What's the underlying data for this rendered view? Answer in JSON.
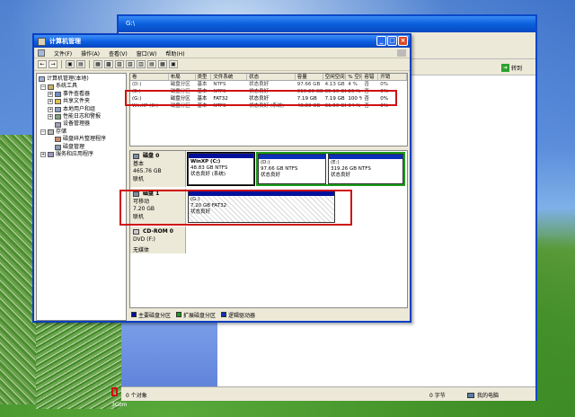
{
  "desktop": {
    "icon_label": "3Com"
  },
  "explorer": {
    "title": "G:\\",
    "go_label": "转到",
    "status_count": "0 个对象",
    "status_size": "0 字节",
    "status_location": "我的电脑"
  },
  "cm": {
    "title": "计算机管理",
    "menu": [
      "文件(F)",
      "操作(A)",
      "查看(V)",
      "窗口(W)",
      "帮助(H)"
    ],
    "toolbar": [
      "←",
      "→",
      "▣",
      "▤",
      "▦",
      "▩",
      "▨",
      "▧",
      "▥",
      "▤",
      "▦",
      "▣"
    ],
    "window_buttons": [
      "_",
      "□",
      "×"
    ]
  },
  "tree": {
    "root": "计算机管理(本地)",
    "system_tools": "系统工具",
    "event_viewer": "事件查看器",
    "shared_folders": "共享文件夹",
    "local_users": "本地用户和组",
    "perf_logs": "性能日志和警报",
    "device_manager": "设备管理器",
    "storage": "存储",
    "defrag": "磁盘碎片整理程序",
    "disk_mgmt": "磁盘管理",
    "services": "服务和应用程序"
  },
  "volumes": {
    "headers": [
      "卷",
      "布局",
      "类型",
      "文件系统",
      "状态",
      "容量",
      "空闲空间",
      "% 空闲",
      "容错",
      "开销"
    ],
    "rows": [
      [
        "(D:)",
        "磁盘分区",
        "基本",
        "NTFS",
        "状态良好",
        "97.66 GB",
        "4.13 GB",
        "4 %",
        "否",
        "0%"
      ],
      [
        "(E:)",
        "磁盘分区",
        "基本",
        "NTFS",
        "状态良好",
        "319.26 GB",
        "85.10 GB",
        "26 %",
        "否",
        "0%"
      ],
      [
        "(G:)",
        "磁盘分区",
        "基本",
        "FAT32",
        "状态良好",
        "7.19 GB",
        "7.19 GB",
        "100 %",
        "否",
        "0%"
      ],
      [
        "WinXP (C:)",
        "磁盘分区",
        "基本",
        "NTFS",
        "状态良好 (系统)",
        "48.83 GB",
        "31.50 GB",
        "64 %",
        "否",
        "0%"
      ]
    ]
  },
  "disks": {
    "disk0": {
      "name": "磁盘 0",
      "type": "基本",
      "size": "465.76 GB",
      "status": "联机",
      "parts": [
        {
          "title": "WinXP  (C:)",
          "size": "48.83 GB NTFS",
          "state": "状态良好 (系统)"
        },
        {
          "title": "(D:)",
          "size": "97.66 GB NTFS",
          "state": "状态良好"
        },
        {
          "title": "(E:)",
          "size": "319.26 GB NTFS",
          "state": "状态良好"
        }
      ]
    },
    "disk1": {
      "name": "磁盘 1",
      "type": "可移动",
      "size": "7.20 GB",
      "status": "联机",
      "part": {
        "title": "(G:)",
        "size": "7.20 GB FAT32",
        "state": "状态良好"
      }
    },
    "cdrom": {
      "name": "CD-ROM 0",
      "type": "DVD (F:)",
      "status": "无媒体"
    }
  },
  "legend": [
    "主要磁盘分区",
    "扩展磁盘分区",
    "逻辑驱动器"
  ],
  "colors": {
    "primary": "#00109a",
    "extended": "#1a9c1a",
    "logical": "#0a2fb8",
    "highlight": "#d01010"
  }
}
